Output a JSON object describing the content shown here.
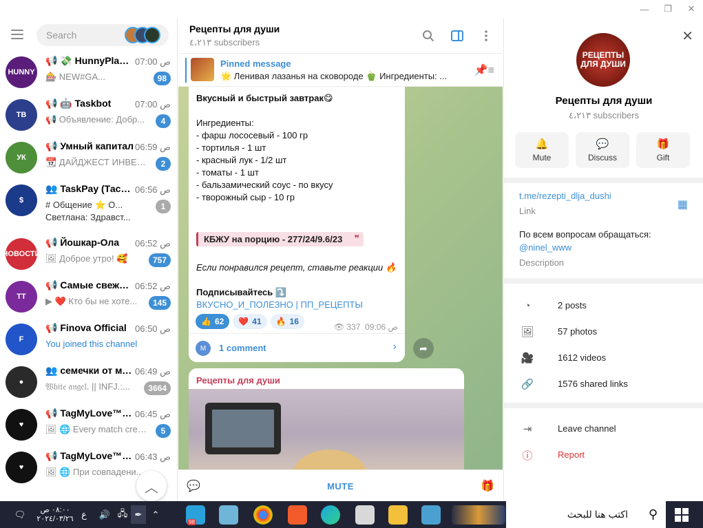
{
  "search": {
    "placeholder": "Search"
  },
  "window_controls": {
    "minimize": "—",
    "maximize": "❐",
    "close": "✕"
  },
  "chats": [
    {
      "name": "📢 💸 HunnyPlay ...",
      "time": "ص 07:00",
      "preview": "🎰 NEW#GA...",
      "badge": "98",
      "avatar_color": "#5a1d7a",
      "avatar_text": "HUNNY"
    },
    {
      "name": "📢 🤖 Taskbot",
      "time": "ص 07:00",
      "preview": "📢 Объявление: Добр...",
      "badge": "4",
      "avatar_color": "#2b3f8c",
      "avatar_text": "TB"
    },
    {
      "name": "📢 Умный капитал",
      "time": "ص 06:59",
      "preview": "📆 ДАЙДЖЕСТ ИНВЕСТ...",
      "badge": "2",
      "avatar_color": "#4e8f3a",
      "avatar_text": "УК"
    },
    {
      "name": "👥 TaskPay (Таскп...",
      "time": "ص 06:56",
      "preview": "# Общение  ⭐ О...",
      "preview2": "Светлана: Здравст...",
      "badge": "1",
      "badge_gray": true,
      "avatar_color": "#1b3a8a",
      "avatar_text": "$"
    },
    {
      "name": "📢 Йошкар-Ола",
      "time": "ص 06:52",
      "preview": "🖼 Доброе утро! 🥰",
      "badge": "757",
      "avatar_color": "#d12d3a",
      "avatar_text": "НОВОСТИ"
    },
    {
      "name": "📢 Самые свежие ...",
      "time": "ص 06:52",
      "preview": "▶ ❤️ Кто бы не хоте...",
      "badge": "145",
      "avatar_color": "#7a2a9a",
      "avatar_text": "TT"
    },
    {
      "name": "📢 Finova Official",
      "time": "ص 06:50",
      "preview": "You joined this channel",
      "preview_blue": true,
      "avatar_color": "#2255c9",
      "avatar_text": "F"
    },
    {
      "name": "👥 семечки от ма...",
      "time": "ص 06:49",
      "preview": "𝔚𝔥𝔦𝔱𝔢 𝔞𝔫𝔤𝔢𝔩. || INFJ.:...",
      "badge": "3664",
      "badge_gray": true,
      "avatar_color": "#2a2a2a",
      "avatar_text": "●"
    },
    {
      "name": "📢 TagMyLove™ N...",
      "time": "ص 06:45",
      "preview": "🖼 🌐 Every match crea...",
      "badge": "5",
      "avatar_color": "#111",
      "avatar_text": "♥"
    },
    {
      "name": "📢 TagMyLove™ N...",
      "time": "ص 06:43",
      "preview": "🖼 🌐 При совпадени...",
      "avatar_color": "#111",
      "avatar_text": "♥"
    }
  ],
  "channel": {
    "title": "Рецепты для души",
    "subscribers": "٤،٢١٣ subscribers",
    "pinned_label": "Pinned message",
    "pinned_text": "🌟 Ленивая лазанья на сковороде 🫑 Ингредиенты: ...",
    "mute": "MUTE"
  },
  "message": {
    "title": "Вкусный и быстрый завтрак😋",
    "ingredients_label": "Ингредиенты:",
    "lines": [
      "- фарш лососевый - 100 гр",
      "- тортилья - 1 шт",
      "- красный лук - 1/2 шт",
      "- томаты - 1 шт",
      "- бальзамический соус - по вкусу",
      "- творожный сыр - 10 гр"
    ],
    "quote": "КБЖУ на порцию - 277/24/9.6/23",
    "italic": "Если понравился рецепт, ставьте реакции 🔥",
    "subscribe": "Подписывайтесь ⤵️",
    "links": "ВКУСНО_И_ПОЛЕЗНО | ПП_РЕЦЕПТЫ",
    "reactions": [
      {
        "emoji": "👍",
        "count": "62"
      },
      {
        "emoji": "❤️",
        "count": "41"
      },
      {
        "emoji": "🔥",
        "count": "16"
      }
    ],
    "views": "337",
    "time": "09:06 ص",
    "comments": "1 comment",
    "comment_avatar": "M"
  },
  "message2": {
    "from": "Рецепты для души"
  },
  "profile": {
    "name": "Рецепты для души",
    "subscribers": "٤،٢١٣ subscribers",
    "avatar_text": "РЕЦЕПТЫ ДЛЯ ДУШИ",
    "actions": [
      {
        "icon": "bell-icon",
        "label": "Mute"
      },
      {
        "icon": "chat-bubble-icon",
        "label": "Discuss"
      },
      {
        "icon": "gift-icon",
        "label": "Gift"
      }
    ],
    "link": "t.me/rezepti_dlja_dushi",
    "link_label": "Link",
    "description": "По всем вопросам обращаться:",
    "handle": "@ninel_www",
    "description_label": "Description",
    "media": [
      "2 posts",
      "57 photos",
      "1612 videos",
      "1576 shared links"
    ],
    "leave": "Leave channel",
    "report": "Report"
  },
  "taskbar": {
    "search_placeholder": "اكتب هنا للبحث",
    "time": "٠٨:٠٠ ص",
    "date": "٢٠٢٤/٠٣/٢٦",
    "lang": "ع",
    "telegram_badge": "98"
  },
  "colors": {
    "accent": "#3d8fd6",
    "danger": "#d33333",
    "taskbar": "#1f2333"
  }
}
